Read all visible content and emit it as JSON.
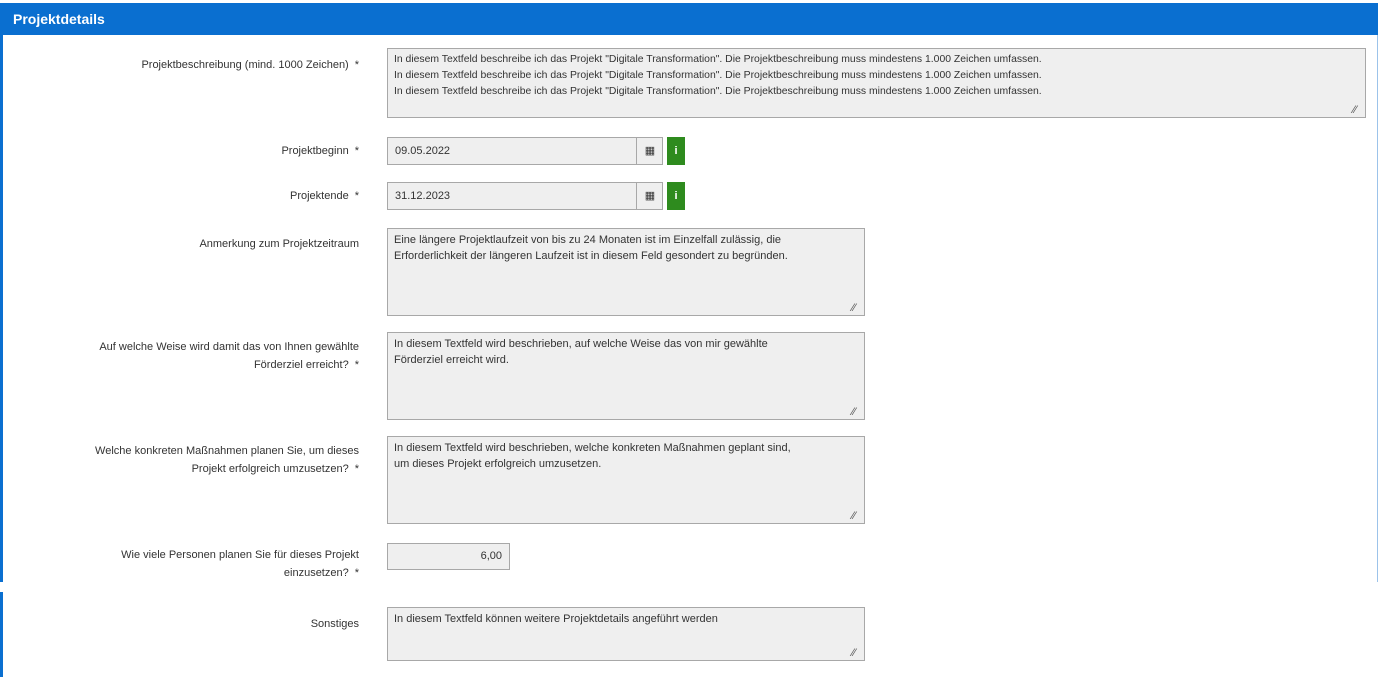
{
  "section": {
    "title": "Projektdetails"
  },
  "required_marker": "*",
  "fields": {
    "beschreibung": {
      "label": "Projektbeschreibung (mind. 1000 Zeichen)",
      "value": "In diesem Textfeld beschreibe ich das Projekt \"Digitale Transformation\". Die Projektbeschreibung muss mindestens 1.000 Zeichen umfassen.\nIn diesem Textfeld beschreibe ich das Projekt \"Digitale Transformation\". Die Projektbeschreibung muss mindestens 1.000 Zeichen umfassen.\nIn diesem Textfeld beschreibe ich das Projekt \"Digitale Transformation\". Die Projektbeschreibung muss mindestens 1.000 Zeichen umfassen."
    },
    "beginn": {
      "label": "Projektbeginn",
      "value": "09.05.2022"
    },
    "ende": {
      "label": "Projektende",
      "value": "31.12.2023"
    },
    "anmerkung": {
      "label": "Anmerkung zum Projektzeitraum",
      "value": "Eine längere Projektlaufzeit von bis zu 24 Monaten ist im Einzelfall zulässig, die\nErforderlichkeit der längeren Laufzeit ist in diesem Feld gesondert zu begründen."
    },
    "weise": {
      "label_line1": "Auf welche Weise wird damit das von Ihnen gewählte",
      "label_line2": "Förderziel erreicht?",
      "value": "In diesem Textfeld wird beschrieben, auf welche Weise das von mir gewählte\nFörderziel erreicht wird."
    },
    "massnahmen": {
      "label_line1": "Welche konkreten Maßnahmen planen Sie, um dieses",
      "label_line2": "Projekt erfolgreich umzusetzen?",
      "value": "In diesem Textfeld wird beschrieben, welche konkreten Maßnahmen geplant sind,\num dieses Projekt erfolgreich umzusetzen."
    },
    "personen": {
      "label_line1": "Wie viele Personen planen Sie für dieses Projekt",
      "label_line2": "einzusetzen?",
      "value": "6,00"
    },
    "sonstiges": {
      "label": "Sonstiges",
      "value": "In diesem Textfeld können weitere Projektdetails angeführt werden"
    }
  },
  "icons": {
    "calendar": "calendar-icon",
    "info": "info-icon",
    "resize": "resize-grip-icon"
  },
  "icon_glyphs": {
    "calendar": "▦",
    "info": "i",
    "resize": "⁄⁄"
  },
  "colors": {
    "header": "#0a6fd0",
    "info_button": "#2e8b1e",
    "field_bg": "#efefef"
  }
}
